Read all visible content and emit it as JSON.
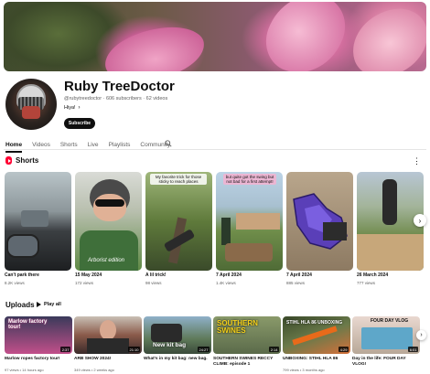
{
  "channel": {
    "name": "Ruby TreeDoctor",
    "handle": "@rubytreedoctor",
    "subscribers": "606 subscribers",
    "videos": "62 videos",
    "description": "Hiya!",
    "subscribe_label": "Subscribe"
  },
  "tabs": [
    "Home",
    "Videos",
    "Shorts",
    "Live",
    "Playlists",
    "Community"
  ],
  "shorts": {
    "title": "Shorts",
    "items": [
      {
        "title": "Can't park there",
        "views": "8.2K views",
        "caption": ""
      },
      {
        "title": "15 May 2024",
        "views": "172 views",
        "caption": "Arborist edition"
      },
      {
        "title": "A lil trick!",
        "views": "98 views",
        "caption": "My favorite trick for those sticky to reach places"
      },
      {
        "title": "7 April 2024",
        "views": "1.4K views",
        "caption": "but quite got the swing but not bad for a first attempt!"
      },
      {
        "title": "7 April 2024",
        "views": "885 views",
        "caption": ""
      },
      {
        "title": "26 March 2024",
        "views": "777 views",
        "caption": ""
      }
    ]
  },
  "uploads": {
    "title": "Uploads",
    "play_all": "Play all",
    "items": [
      {
        "title": "Marlow ropes factory tour!",
        "meta": "97 views • 14 hours ago",
        "duration": "2:37",
        "overlay": "Marlow factory tour!"
      },
      {
        "title": "ARB SHOW 2024!",
        "meta": "349 views • 2 weeks ago",
        "duration": "21:10",
        "overlay": ""
      },
      {
        "title": "What's in my kit bag: new bag.",
        "meta": "",
        "duration": "24:27",
        "overlay": "New kit bag"
      },
      {
        "title": "SOUTHERN SWINES RECCY CLIMB: episode 1",
        "meta": "",
        "duration": "2:14",
        "overlay": "SOUTHERN SWINES"
      },
      {
        "title": "UNBOXING: STIHL HLA 86",
        "meta": "799 views • 3 months ago",
        "duration": "4:29",
        "overlay": "STIHL HLA 86 UNBOXING"
      },
      {
        "title": "Day in the life: FOUR DAY VLOG!",
        "meta": "",
        "duration": "6:01",
        "overlay": "FOUR DAY VLOG"
      }
    ]
  },
  "colors": {
    "accent": "#ff0033",
    "text": "#0f0f0f",
    "muted": "#606060"
  }
}
